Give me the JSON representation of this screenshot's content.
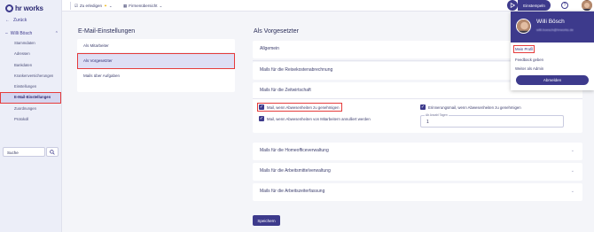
{
  "app": {
    "logo_text": "hr works"
  },
  "sidebar": {
    "back_label": "Zurück",
    "user_label": "Willi Bösch",
    "items": [
      {
        "label": "Stammdaten"
      },
      {
        "label": "Adressen"
      },
      {
        "label": "Bankdaten"
      },
      {
        "label": "Krankenversicherungen"
      },
      {
        "label": "Einstellungen"
      },
      {
        "label": "E-Mail-Einstellungen",
        "active": true
      },
      {
        "label": "Zuordnungen"
      },
      {
        "label": "Protokoll"
      }
    ],
    "search_value": "Suche"
  },
  "topbar": {
    "todo_label": "Zu erledigen",
    "overview_label": "Firmenübersicht",
    "clock_in_label": "Einstempeln"
  },
  "left_panel": {
    "title": "E-Mail-Einstellungen",
    "items": [
      {
        "label": "Als Mitarbeiter"
      },
      {
        "label": "Als Vorgesetzter",
        "active": true
      },
      {
        "label": "Mails über Aufgaben"
      }
    ]
  },
  "right_panel": {
    "title": "Als Vorgesetzter",
    "sections": {
      "allgemein": "Allgemein",
      "reise": "Mails für die Reisekostenabrechnung",
      "zeit": "Mails für die Zeitwirtschaft",
      "homeoffice": "Mails für die Homeofficeverwaltung",
      "arbeitsmittel": "Mails für die Arbeitsmittelverwaltung",
      "arbeitszeit": "Mails für die Arbeitszeiterfassung"
    },
    "checkboxes": {
      "absence_approve": "Mail, wenn Abwesenheiten zu genehmigen",
      "absence_cancel": "Mail, wenn Abwesenheiten von Mitarbeitern annulliert werden",
      "reminder": "Erinnerungsmail, wenn Abwesenheiten zu genehmigen"
    },
    "reminder_field": {
      "label": "Ab Anzahl Tagen",
      "value": "1"
    },
    "save_label": "Speichern"
  },
  "profile_menu": {
    "name": "Willi Bösch",
    "email": "willi.boesch@hrworks.de",
    "links": {
      "profile": "Mein Profil",
      "feedback": "Feedback geben",
      "admin": "Weiter als Admin"
    },
    "logout_label": "Abmelden"
  },
  "colors": {
    "primary": "#3d3a8c",
    "highlight": "#e53b3b",
    "background": "#f4f5f9"
  }
}
